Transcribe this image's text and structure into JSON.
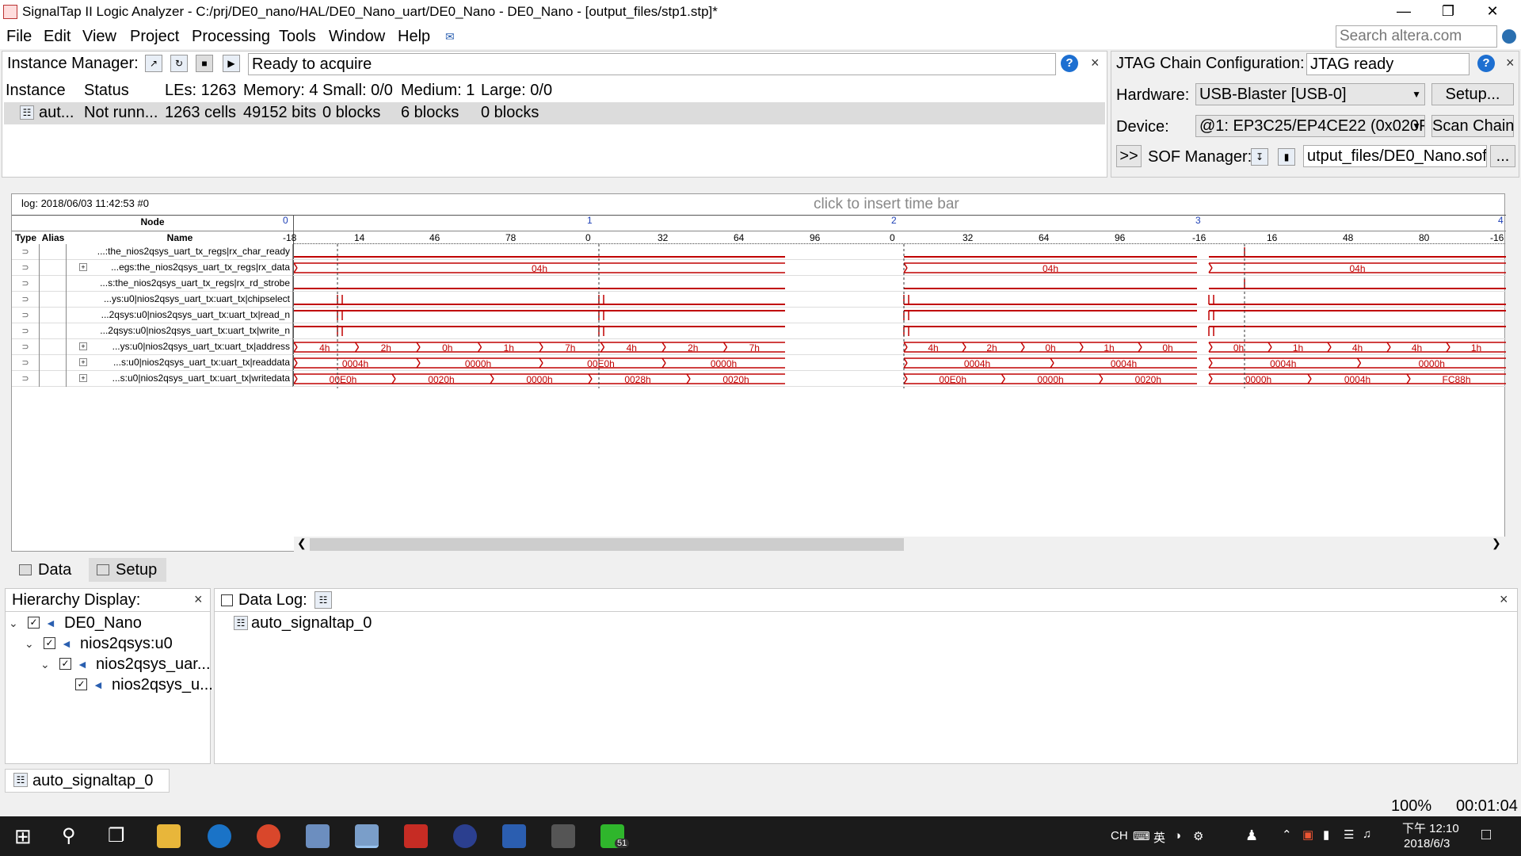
{
  "window": {
    "title": "SignalTap II Logic Analyzer - C:/prj/DE0_nano/HAL/DE0_Nano_uart/DE0_Nano - DE0_Nano - [output_files/stp1.stp]*"
  },
  "menu": [
    "File",
    "Edit",
    "View",
    "Project",
    "Processing",
    "Tools",
    "Window",
    "Help"
  ],
  "search": {
    "placeholder": "Search altera.com"
  },
  "instance_manager": {
    "label": "Instance Manager:",
    "status": "Ready to acquire",
    "columns": [
      "Instance",
      "Status",
      "LEs: 1263",
      "Memory: 4",
      "Small: 0/0",
      "Medium: 1",
      "Large: 0/0"
    ],
    "row": [
      "aut...",
      "Not runn...",
      "1263 cells",
      "49152 bits",
      "0 blocks",
      "6 blocks",
      "0 blocks"
    ]
  },
  "jtag": {
    "label": "JTAG Chain Configuration:",
    "status": "JTAG ready",
    "hardware_label": "Hardware:",
    "hardware_value": "USB-Blaster [USB-0]",
    "setup_button": "Setup...",
    "device_label": "Device:",
    "device_value": "@1: EP3C25/EP4CE22 (0x020F",
    "scan_button": "Scan Chain",
    "sof_expand": ">>",
    "sof_label": "SOF Manager:",
    "sof_value": "utput_files/DE0_Nano.sof",
    "browse_button": "..."
  },
  "waveform": {
    "log": "log: 2018/06/03 11:42:53  #0",
    "timebar_hint": "click to insert time bar",
    "headers": {
      "node": "Node",
      "type": "Type",
      "alias": "Alias",
      "name": "Name"
    },
    "segment_marks": [
      "0",
      "1",
      "2",
      "3",
      "4"
    ],
    "ticks": [
      "-18",
      "14",
      "46",
      "78",
      "0",
      "32",
      "64",
      "96",
      "0",
      "32",
      "64",
      "96",
      "-16",
      "16",
      "48",
      "80",
      "-16"
    ],
    "signals": [
      {
        "name": "...:the_nios2qsys_uart_tx_regs|rx_char_ready",
        "expandable": false,
        "values": []
      },
      {
        "name": "...egs:the_nios2qsys_uart_tx_regs|rx_data",
        "expandable": true,
        "values": [
          "04h",
          "04h",
          "04h"
        ]
      },
      {
        "name": "...s:the_nios2qsys_uart_tx_regs|rx_rd_strobe",
        "expandable": false,
        "values": []
      },
      {
        "name": "...ys:u0|nios2qsys_uart_tx:uart_tx|chipselect",
        "expandable": false,
        "values": []
      },
      {
        "name": "...2qsys:u0|nios2qsys_uart_tx:uart_tx|read_n",
        "expandable": false,
        "values": []
      },
      {
        "name": "...2qsys:u0|nios2qsys_uart_tx:uart_tx|write_n",
        "expandable": false,
        "values": []
      },
      {
        "name": "...ys:u0|nios2qsys_uart_tx:uart_tx|address",
        "expandable": true,
        "values": [
          "4h",
          "2h",
          "0h",
          "1h",
          "7h",
          "4h",
          "2h",
          "7h",
          "4h",
          "2h",
          "0h",
          "1h",
          "0h",
          "0h",
          "1h",
          "4h",
          "4h",
          "1h"
        ]
      },
      {
        "name": "...s:u0|nios2qsys_uart_tx:uart_tx|readdata",
        "expandable": true,
        "values": [
          "0004h",
          "0000h",
          "00E0h",
          "0000h",
          "0004h",
          "0004h",
          "0004h",
          "0000h"
        ]
      },
      {
        "name": "...s:u0|nios2qsys_uart_tx:uart_tx|writedata",
        "expandable": true,
        "values": [
          "00E0h",
          "0020h",
          "0000h",
          "0028h",
          "0020h",
          "00E0h",
          "0000h",
          "0020h",
          "0000h",
          "0004h",
          "FC88h"
        ]
      }
    ]
  },
  "tabs": [
    "Data",
    "Setup"
  ],
  "hierarchy": {
    "label": "Hierarchy Display:",
    "items": [
      "DE0_Nano",
      "nios2qsys:u0",
      "nios2qsys_uar...",
      "nios2qsys_u..."
    ]
  },
  "datalog": {
    "label": "Data Log:",
    "item": "auto_signaltap_0"
  },
  "instance_tab": "auto_signaltap_0",
  "statusbar": {
    "zoom": "100%",
    "time": "00:01:04"
  },
  "taskbar": {
    "ime": "CH",
    "ime2": "英",
    "clock_time": "下午 12:10",
    "clock_date": "2018/6/3",
    "badge": "51"
  },
  "colors": {
    "signal": "#c00000",
    "accent": "#1d6fd1",
    "taskbar": "#1b1b1b"
  }
}
